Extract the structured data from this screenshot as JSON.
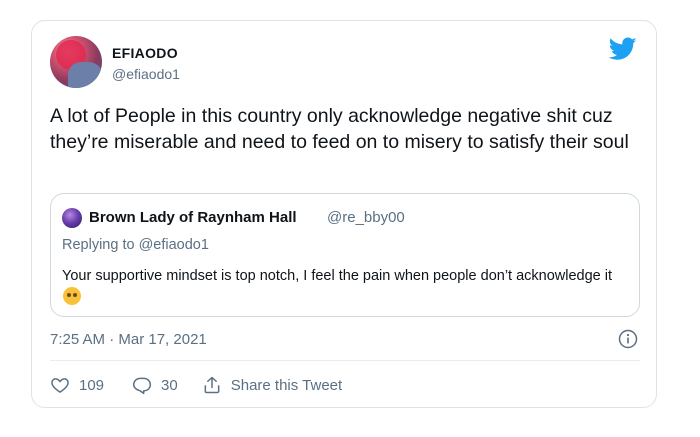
{
  "author": {
    "display_name": "EFIAODO",
    "handle": "@efiaodo1",
    "avatar_icon": "profile-photo"
  },
  "brand_icon": "twitter-bird-icon",
  "tweet": {
    "text": "A lot of People in this country only acknowledge negative shit cuz they’re miserable and need to feed on to misery to satisfy their soul",
    "timestamp": "7:25 AM · Mar 17, 2021"
  },
  "quoted_tweet": {
    "display_name": "Brown Lady of Raynham Hall",
    "handle": "@re_bby00",
    "replying_prefix": "Replying to ",
    "replying_to": "@efiaodo1",
    "text": "Your supportive mindset is top notch, I feel the pain when people don’t acknowledge it"
  },
  "actions": {
    "like_count": "109",
    "reply_count": "30",
    "share_label": "Share this Tweet"
  },
  "colors": {
    "accent": "#1da1f2",
    "secondary_text": "#5b7083",
    "border": "#cfd9de"
  }
}
